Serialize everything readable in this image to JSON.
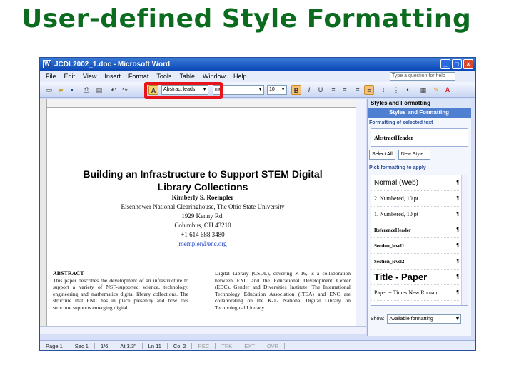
{
  "slide": {
    "title": "User-defined Style Formatting"
  },
  "window": {
    "title": "JCDL2002_1.doc - Microsoft Word",
    "menu": [
      "File",
      "Edit",
      "View",
      "Insert",
      "Format",
      "Tools",
      "Table",
      "Window",
      "Help"
    ],
    "help_placeholder": "Type a question for help"
  },
  "toolbar": {
    "style_value": "Abstract leads",
    "font_value": "me",
    "size_value": "10",
    "bold": "B",
    "italic": "I",
    "underline": "U"
  },
  "document": {
    "title_line1": "Building an Infrastructure to Support STEM Digital",
    "title_line2": "Library Collections",
    "author_name": "Kimberly S. Roempler",
    "affiliation": "Eisenhower National Clearinghouse, The Ohio State University",
    "address1": "1929 Kenny Rd.",
    "address2": "Columbus, OH 43210",
    "phone": "+1 614 688 3480",
    "email": "roempler@enc.org",
    "abstract_heading": "ABSTRACT",
    "abstract_text": "This paper describes the development of an infrastructure to support a variety of NSF-supported science, technology, engineering and mathematics digital library collections. The structure that ENC has in place presently and how this structure supports emerging digital",
    "right_col_text": "Digital Library (CSDL), covering K-16, is a collaboration between ENC and the Educational Development Center (EDC), Gender and Diversities Institute, The International Technology Education Association (ITEA) and ENC are collaborating on the K-12 National Digital Library on Technological Literacy"
  },
  "statusbar": {
    "page": "Page 1",
    "sec": "Sec 1",
    "pages": "1/6",
    "at": "At 3.3\"",
    "ln": "Ln 11",
    "col": "Col 2",
    "rec": "REC",
    "trk": "TRK",
    "ext": "EXT",
    "ovr": "OVR"
  },
  "taskpane": {
    "header": "Styles and Formatting",
    "nav_title": "Styles and Formatting",
    "formatting_label": "Formatting of selected text",
    "selected_style": "AbstractHeader",
    "select_all": "Select All",
    "new_style": "New Style...",
    "pick_label": "Pick formatting to apply",
    "styles": [
      {
        "label": "Normal (Web)",
        "kind": "web"
      },
      {
        "label": "2. Numbered, 10 pt",
        "kind": "num"
      },
      {
        "label": "1. Numbered, 10 pt",
        "kind": "num"
      },
      {
        "label": "ReferenceHeader",
        "kind": "bold"
      },
      {
        "label": "Section_level1",
        "kind": "bold"
      },
      {
        "label": "Section_level2",
        "kind": "bold"
      },
      {
        "label": "Title - Paper",
        "kind": "title"
      },
      {
        "label": "Paper + Times New Roman",
        "kind": "tnr"
      }
    ],
    "show_label": "Show:",
    "show_value": "Available formatting"
  }
}
